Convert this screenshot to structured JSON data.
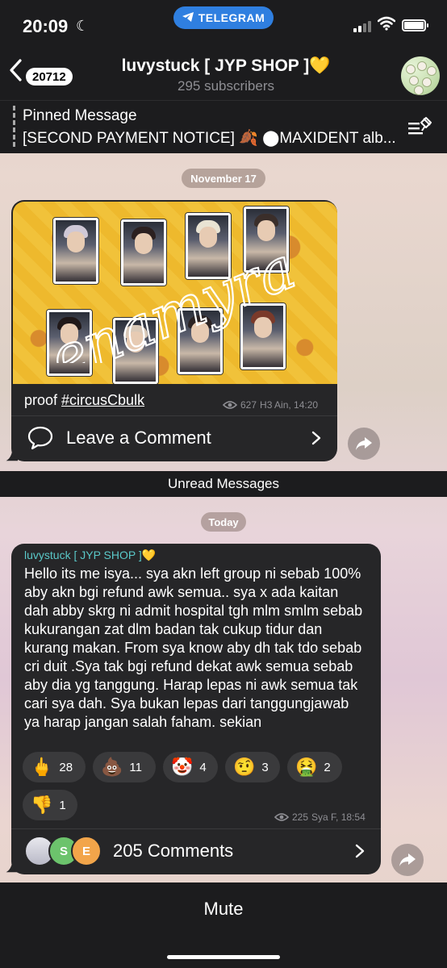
{
  "status_bar": {
    "time": "20:09",
    "app_pill": "TELEGRAM"
  },
  "header": {
    "back_count": "20712",
    "title": "luvystuck [ JYP SHOP ]💛",
    "subtitle": "295 subscribers"
  },
  "pinned": {
    "label": "Pinned Message",
    "text": "[SECOND PAYMENT NOTICE] 🍂 ⬤MAXIDENT alb..."
  },
  "messages": [
    {
      "date": "November 17",
      "watermark": "enamyra",
      "caption_prefix": "proof ",
      "caption_tag": "#circusCbulk",
      "views": "627",
      "signature_time": "H3 Ain, 14:20",
      "comment_label": "Leave a Comment"
    },
    {
      "date": "Today",
      "author": "luvystuck [ JYP SHOP ]💛",
      "text": "Hello  its me isya... sya akn left group ni sebab 100% aby akn bgi refund awk semua.. sya x ada kaitan dah abby skrg ni admit hospital tgh mlm smlm sebab kukurangan zat dlm badan tak cukup tidur dan kurang makan. From sya know aby dh tak tdo sebab cri duit .Sya tak bgi refund dekat awk semua sebab aby dia yg tanggung. Harap lepas ni awk semua tak cari sya dah. Sya bukan lepas dari tanggungjawab ya harap jangan salah faham. sekian",
      "reactions": [
        {
          "emoji": "🖕",
          "count": "28"
        },
        {
          "emoji": "💩",
          "count": "11"
        },
        {
          "emoji": "🤡",
          "count": "4"
        },
        {
          "emoji": "🤨",
          "count": "3"
        },
        {
          "emoji": "🤮",
          "count": "2"
        },
        {
          "emoji": "👎",
          "count": "1"
        }
      ],
      "views": "225",
      "signature_time": "Sya F, 18:54",
      "commenter_initials": [
        "S",
        "E"
      ],
      "comments_label": "205 Comments"
    }
  ],
  "unread_label": "Unread Messages",
  "footer": {
    "mute_label": "Mute"
  }
}
